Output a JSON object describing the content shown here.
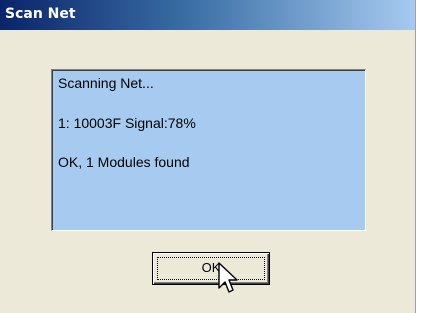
{
  "window": {
    "title": "Scan Net"
  },
  "log": {
    "lines": [
      "Scanning Net...",
      "1: 10003F  Signal:78%",
      "OK, 1 Modules found"
    ]
  },
  "buttons": {
    "ok_label": "OK"
  },
  "colors": {
    "titlebar_start": "#0a246a",
    "titlebar_end": "#a6caf0",
    "panel_bg": "#a6caf0",
    "dialog_bg": "#ece9d8"
  },
  "icons": {
    "cursor": "arrow-pointer-icon"
  }
}
